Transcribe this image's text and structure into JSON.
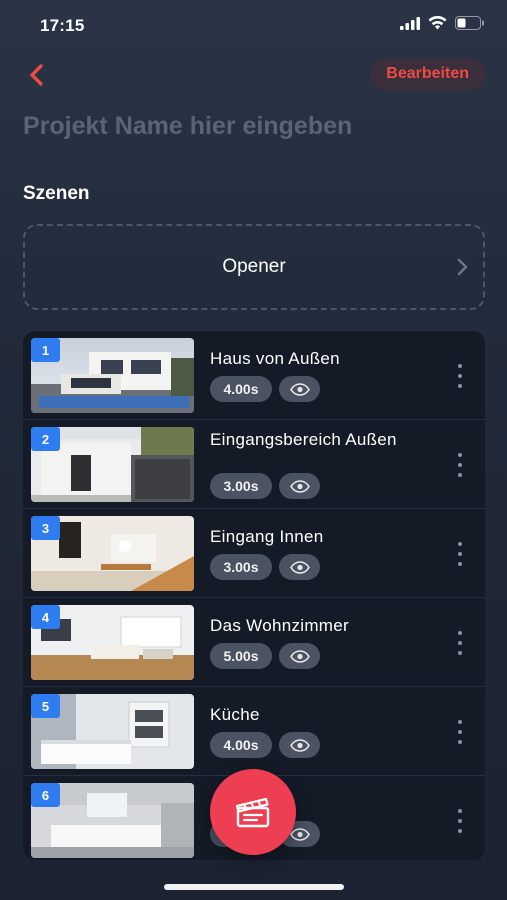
{
  "status": {
    "time": "17:15"
  },
  "header": {
    "edit_label": "Bearbeiten"
  },
  "project": {
    "name_placeholder": "Projekt Name hier eingeben"
  },
  "section": {
    "title": "Szenen"
  },
  "opener": {
    "label": "Opener"
  },
  "scenes": [
    {
      "number": "1",
      "title": "Haus von Außen",
      "duration": "4.00s"
    },
    {
      "number": "2",
      "title": "Eingangsbereich Außen",
      "duration": "3.00s"
    },
    {
      "number": "3",
      "title": "Eingang Innen",
      "duration": "3.00s"
    },
    {
      "number": "4",
      "title": "Das Wohnzimmer",
      "duration": "5.00s"
    },
    {
      "number": "5",
      "title": "Küche",
      "duration": "4.00s"
    },
    {
      "number": "6",
      "title": "",
      "duration": "4"
    }
  ],
  "colors": {
    "accent": "#ee3e52",
    "badge": "#2f7bf0",
    "edit_text": "#ef4a44"
  },
  "icons": [
    "back-chevron-icon",
    "chevron-right-icon",
    "eye-icon",
    "more-vertical-icon",
    "clapperboard-icon",
    "signal-icon",
    "wifi-icon",
    "battery-icon"
  ]
}
